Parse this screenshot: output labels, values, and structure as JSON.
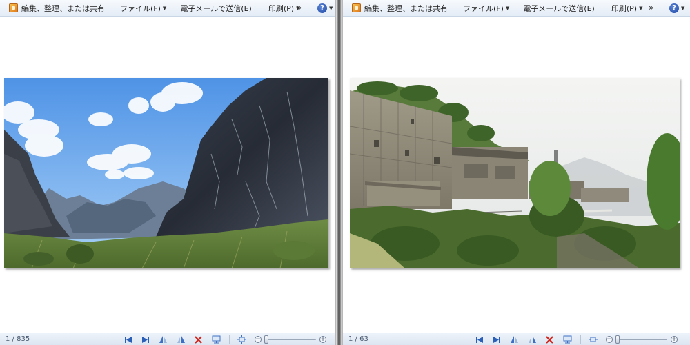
{
  "windows": [
    {
      "menu": {
        "organize_label": "編集、整理、または共有",
        "file_label": "ファイル(F)",
        "email_label": "電子メールで送信(E)",
        "print_label": "印刷(P)",
        "more_label": "»",
        "help_label": "?"
      },
      "photo": {
        "subject": "mountain valley"
      },
      "status": {
        "counter": "1 / 835"
      }
    },
    {
      "menu": {
        "organize_label": "編集、整理、または共有",
        "file_label": "ファイル(F)",
        "email_label": "電子メールで送信(E)",
        "print_label": "印刷(P)",
        "more_label": "»",
        "help_label": "?"
      },
      "photo": {
        "subject": "industrial building on hillside"
      },
      "status": {
        "counter": "1 / 63"
      }
    }
  ],
  "colors": {
    "nav": "#2a5fb8",
    "delete": "#d2261d",
    "accent": "#3d6fc4"
  },
  "icons": [
    "previous-icon",
    "next-icon",
    "rotate-left-icon",
    "rotate-right-icon",
    "delete-icon",
    "slideshow-icon",
    "actual-size-icon",
    "zoom-out-icon",
    "zoom-in-icon"
  ]
}
